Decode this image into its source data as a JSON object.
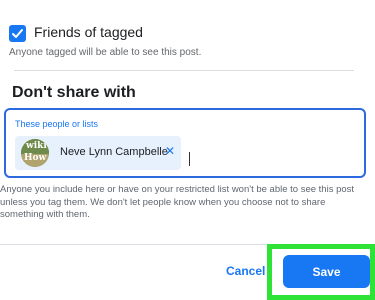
{
  "friends_of_tagged": {
    "label": "Friends of tagged",
    "help": "Anyone tagged will be able to see this post."
  },
  "dont_share": {
    "title": "Don't share with",
    "input_label": "These people or lists",
    "chips": [
      {
        "name": "Neve Lynn Campbelle",
        "avatar_text_line1": "wiki",
        "avatar_text_line2": "How"
      }
    ],
    "help": "Anyone you include here or have on your restricted list won't be able to see this post unless you tag them. We don't let people know when you choose not to share something with them."
  },
  "footer": {
    "cancel_label": "Cancel",
    "save_label": "Save"
  },
  "colors": {
    "accent": "#1877f2",
    "highlight": "#2fe336"
  }
}
